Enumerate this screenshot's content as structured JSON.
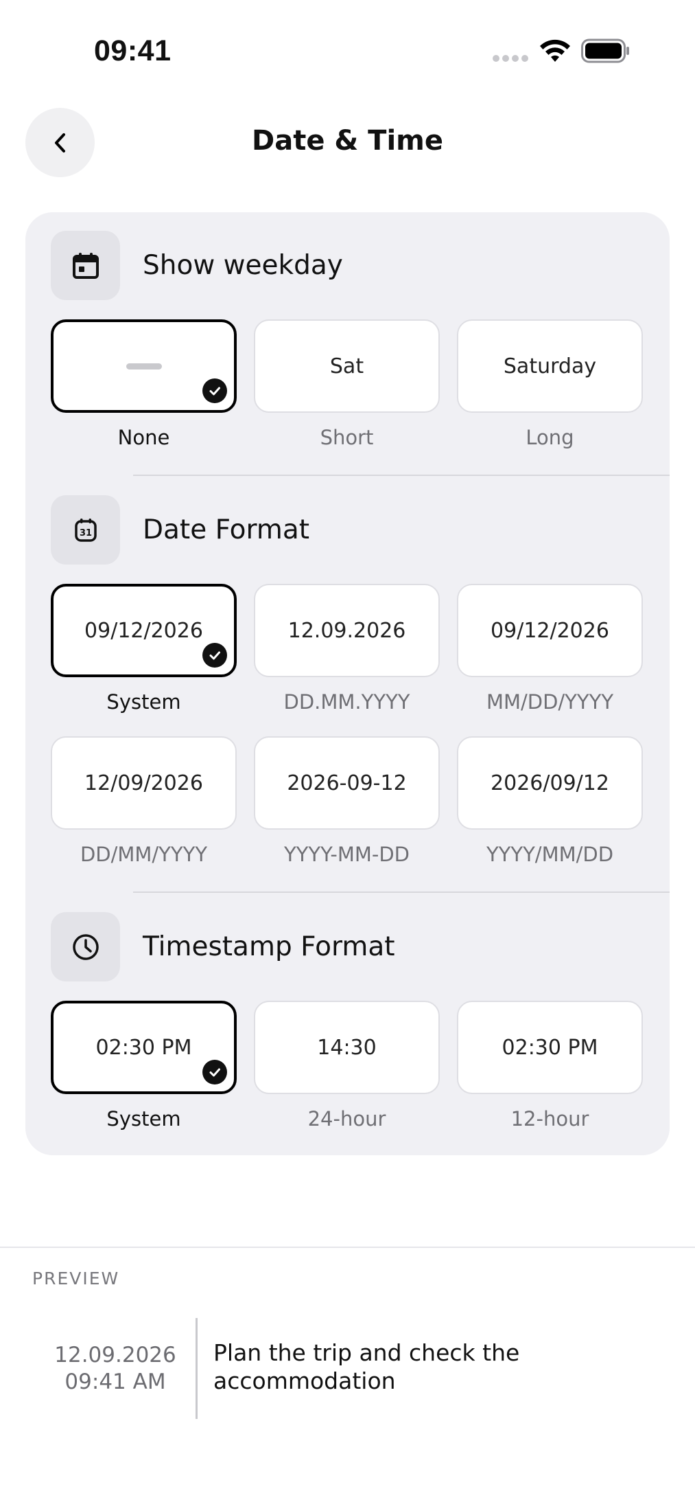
{
  "status_bar": {
    "time": "09:41"
  },
  "header": {
    "title": "Date & Time"
  },
  "weekday": {
    "title": "Show weekday",
    "icon": "calendar-icon",
    "options": [
      {
        "value": "",
        "label": "None",
        "selected": true
      },
      {
        "value": "Sat",
        "label": "Short",
        "selected": false
      },
      {
        "value": "Saturday",
        "label": "Long",
        "selected": false
      }
    ]
  },
  "date_format": {
    "title": "Date Format",
    "icon": "calendar-31-icon",
    "options": [
      {
        "value": "09/12/2026",
        "label": "System",
        "selected": true
      },
      {
        "value": "12.09.2026",
        "label": "DD.MM.YYYY",
        "selected": false
      },
      {
        "value": "09/12/2026",
        "label": "MM/DD/YYYY",
        "selected": false
      },
      {
        "value": "12/09/2026",
        "label": "DD/MM/YYYY",
        "selected": false
      },
      {
        "value": "2026-09-12",
        "label": "YYYY-MM-DD",
        "selected": false
      },
      {
        "value": "2026/09/12",
        "label": "YYYY/MM/DD",
        "selected": false
      }
    ]
  },
  "timestamp_format": {
    "title": "Timestamp Format",
    "icon": "clock-icon",
    "options": [
      {
        "value": "02:30 PM",
        "label": "System",
        "selected": true
      },
      {
        "value": "14:30",
        "label": "24-hour",
        "selected": false
      },
      {
        "value": "02:30 PM",
        "label": "12-hour",
        "selected": false
      }
    ]
  },
  "preview": {
    "heading": "PREVIEW",
    "date": "12.09.2026",
    "time": "09:41 AM",
    "text": "Plan the trip and check the accommodation"
  },
  "colors": {
    "selected_border": "#000000",
    "card_bg": "#f0f0f4",
    "check_bg": "#111111"
  }
}
